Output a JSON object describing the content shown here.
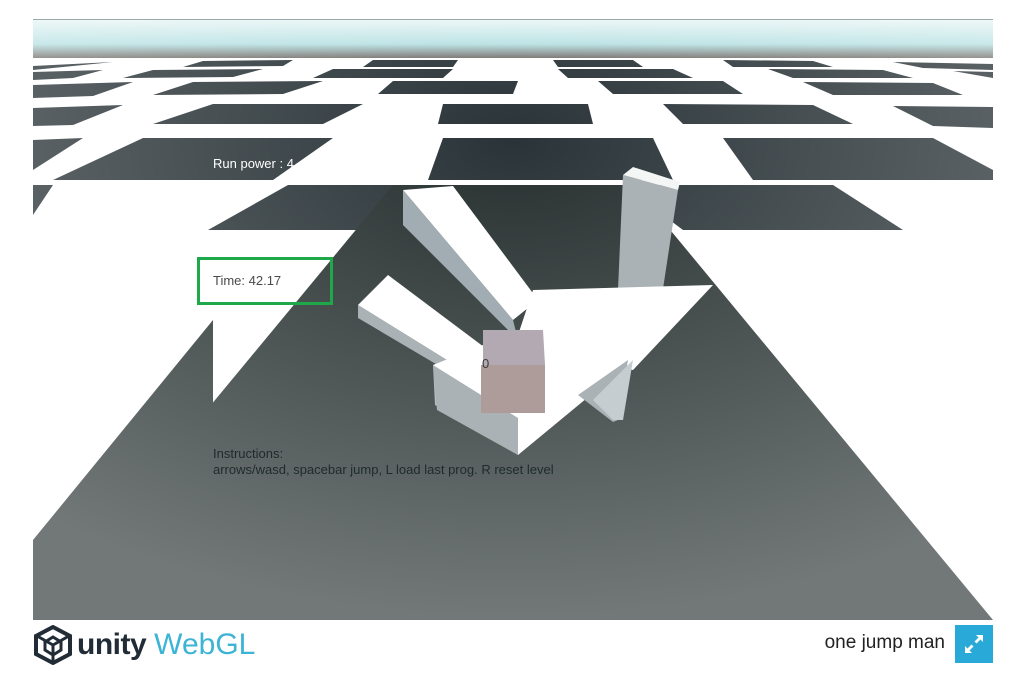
{
  "game": {
    "run_power_text": "Run power : 4",
    "time_text": "Time: 42.17",
    "cube_label": "0",
    "instructions_title": "Instructions:",
    "instructions_text": "arrows/wasd, spacebar jump, L load last prog.",
    "instructions_text_end": "R reset level"
  },
  "footer": {
    "brand_unity": "unity",
    "brand_webgl": "WebGL",
    "title": "one jump man",
    "fullscreen_icon": "fullscreen-icon",
    "accent_color": "#29a9d7"
  },
  "colors": {
    "sky": "#cfe9ea",
    "dark_tile": "#2a3438",
    "light_tile": "#ffffff",
    "highlight_box": "#1ea84a"
  }
}
